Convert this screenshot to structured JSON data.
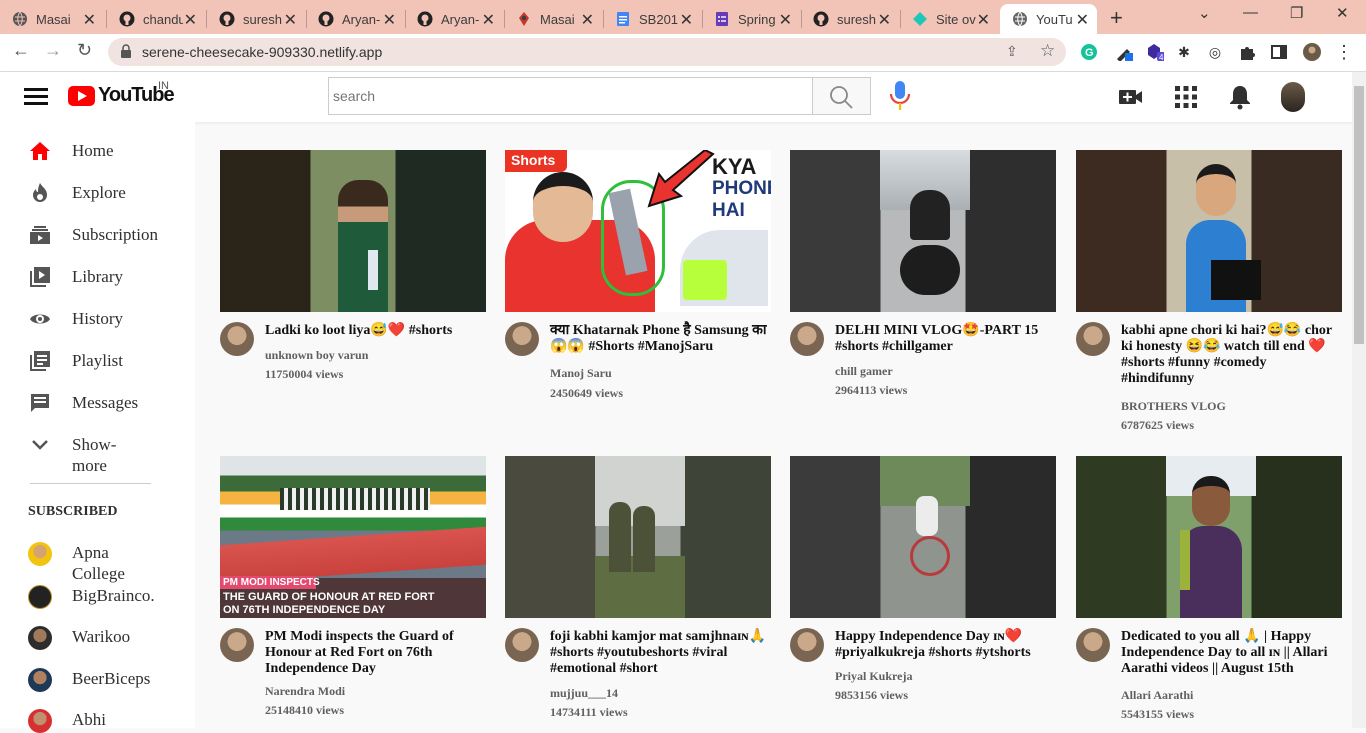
{
  "browser": {
    "tabs": [
      {
        "label": "Masai",
        "icon": "globe-icon"
      },
      {
        "label": "chandu",
        "icon": "github-icon"
      },
      {
        "label": "suresh",
        "icon": "github-icon"
      },
      {
        "label": "Aryan-",
        "icon": "github-icon"
      },
      {
        "label": "Aryan-",
        "icon": "github-icon"
      },
      {
        "label": "Masai",
        "icon": "masai-icon"
      },
      {
        "label": "SB201",
        "icon": "docs-icon"
      },
      {
        "label": "Spring",
        "icon": "forms-icon"
      },
      {
        "label": "suresh",
        "icon": "github-icon"
      },
      {
        "label": "Site ov",
        "icon": "netlify-icon"
      },
      {
        "label": "YouTu",
        "icon": "globe-icon",
        "active": true
      }
    ],
    "url": "serene-cheesecake-909330.netlify.app"
  },
  "youtube": {
    "logo_text": "YouTube",
    "country_code": "IN",
    "search_placeholder": "search",
    "colors": {
      "brand": "#ff0000",
      "mic": "#4285f4"
    }
  },
  "sidebar": {
    "items": [
      {
        "label": "Home",
        "icon": "home-icon"
      },
      {
        "label": "Explore",
        "icon": "explore-icon"
      },
      {
        "label": "Subscription",
        "icon": "subscriptions-icon"
      },
      {
        "label": "Library",
        "icon": "library-icon"
      },
      {
        "label": "History",
        "icon": "history-icon"
      },
      {
        "label": "Playlist",
        "icon": "playlist-icon"
      },
      {
        "label": "Messages",
        "icon": "messages-icon"
      },
      {
        "label": "Show-\nmore",
        "icon": "chevron-down-icon"
      }
    ],
    "subscribed_heading": "SUBSCRIBED",
    "subscriptions": [
      {
        "label": "Apna College"
      },
      {
        "label": "BigBrainco."
      },
      {
        "label": "Warikoo"
      },
      {
        "label": "BeerBiceps"
      },
      {
        "label": "Abhi"
      }
    ]
  },
  "videos": [
    {
      "title": "Ladki ko loot liya😅❤️ #shorts",
      "channel": "unknown boy varun",
      "views": "11750004 views"
    },
    {
      "title": "क्या Khatarnak Phone है Samsung का 😱😱 #Shorts #ManojSaru",
      "channel": "Manoj Saru",
      "views": "2450649 views"
    },
    {
      "title": "DELHI MINI VLOG🤩-PART 15 #shorts #chillgamer",
      "channel": "chill gamer",
      "views": "2964113 views"
    },
    {
      "title": "kabhi apne chori ki hai?😅😂 chor ki honesty 😆😂 watch till end ❤️ #shorts #funny #comedy #hindifunny",
      "channel": "BROTHERS VLOG",
      "views": "6787625 views"
    },
    {
      "title": "PM Modi inspects the Guard of Honour at Red Fort on 76th Independence Day",
      "channel": "Narendra Modi",
      "views": "25148410 views"
    },
    {
      "title": "foji kabhi kamjor mat samjhnaɪɴ🙏 #shorts #youtubeshorts #viral #emotional #short",
      "channel": "mujjuu___14",
      "views": "14734111 views"
    },
    {
      "title": "Happy Independence Day ɪɴ❤️ #priyalkukreja #shorts #ytshorts",
      "channel": "Priyal Kukreja",
      "views": "9853156 views"
    },
    {
      "title": "Dedicated to you all 🙏 | Happy Independence Day to all ɪɴ || Allari Aarathi videos || August 15th",
      "channel": "Allari Aarathi",
      "views": "5543155 views"
    }
  ],
  "thumbnail_text": {
    "t2_shorts": "Shorts",
    "t2_kya": "KYA",
    "t2_phone": "PHONE",
    "t2_hai": "HAI",
    "t5_line1": "PM MODI INSPECTS",
    "t5_line2": "THE GUARD OF HONOUR AT RED FORT",
    "t5_line3": "ON 76TH INDEPENDENCE DAY"
  }
}
